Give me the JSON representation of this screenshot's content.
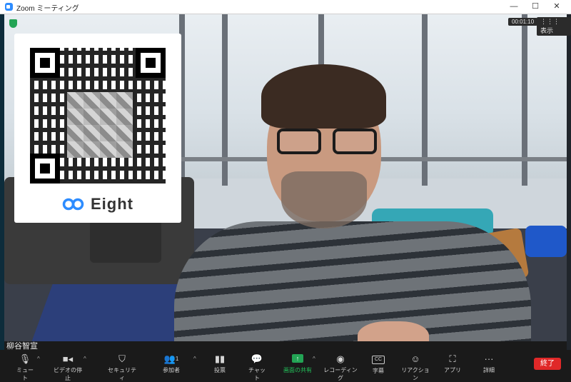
{
  "window": {
    "title": "Zoom ミーティング",
    "minimize": "—",
    "maximize": "☐",
    "close": "✕"
  },
  "video": {
    "timer": "00:01:10",
    "view_label": "表示",
    "participant_name": "柳谷智宣",
    "qr_card_brand": "Eight"
  },
  "toolbar": {
    "mute": "ミュート",
    "video_stop": "ビデオの停止",
    "security": "セキュリティ",
    "participants": "参加者",
    "participants_count": "1",
    "polls": "投票",
    "chat": "チャット",
    "share": "画面の共有",
    "recording": "レコーディング",
    "captions": "字幕",
    "cc_label": "CC",
    "reactions": "リアクション",
    "apps": "アプリ",
    "more": "詳細",
    "end": "終了"
  },
  "colors": {
    "share_green": "#23c25a",
    "end_red": "#e02828",
    "zoom_blue": "#2d8cff"
  }
}
